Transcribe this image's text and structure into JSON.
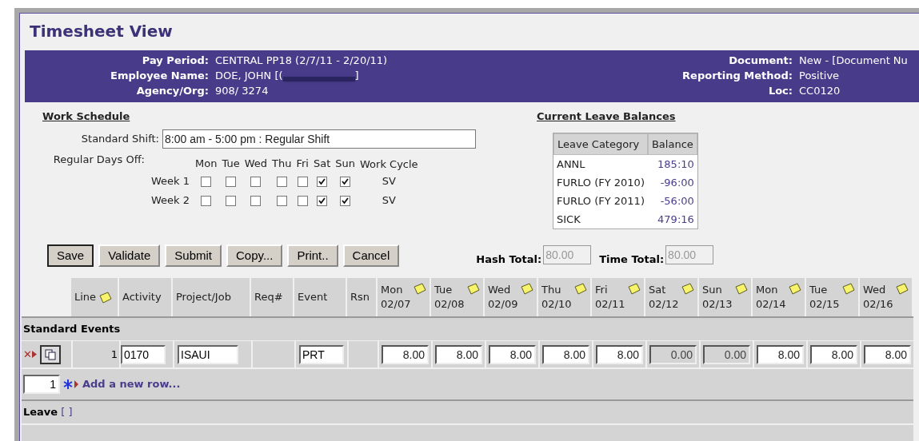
{
  "title": "Timesheet View",
  "header_left": [
    {
      "label": "Pay Period:",
      "value": "CENTRAL PP18 (2/7/11 - 2/20/11)"
    },
    {
      "label": "Employee Name:",
      "value": "DOE, JOHN [(",
      "suffix": "]",
      "redacted": true
    },
    {
      "label": "Agency/Org:",
      "value": "908/ 3274"
    }
  ],
  "header_right": [
    {
      "label": "Document:",
      "value": "New - [Document Nu"
    },
    {
      "label": "Reporting Method:",
      "value": "Positive"
    },
    {
      "label": "Loc:",
      "value": "CC0120"
    }
  ],
  "work_schedule": {
    "heading": "Work Schedule",
    "shift_label": "Standard Shift:",
    "shift_value": "8:00 am - 5:00 pm : Regular Shift",
    "days_off_label": "Regular Days Off:",
    "days": [
      "Mon",
      "Tue",
      "Wed",
      "Thu",
      "Fri",
      "Sat",
      "Sun"
    ],
    "cycle_heading": "Work Cycle",
    "weeks": [
      {
        "label": "Week 1",
        "checked": [
          false,
          false,
          false,
          false,
          false,
          true,
          true
        ],
        "cycle": "SV"
      },
      {
        "label": "Week 2",
        "checked": [
          false,
          false,
          false,
          false,
          false,
          true,
          true
        ],
        "cycle": "SV"
      }
    ]
  },
  "leave_balances": {
    "heading": "Current Leave Balances",
    "columns": [
      "Leave Category",
      "Balance"
    ],
    "rows": [
      [
        "ANNL",
        "185:10"
      ],
      [
        "FURLO (FY 2010)",
        "-96:00"
      ],
      [
        "FURLO (FY 2011)",
        "-56:00"
      ],
      [
        "SICK",
        "479:16"
      ]
    ]
  },
  "buttons": [
    {
      "label": "Save",
      "selected": true
    },
    {
      "label": "Validate",
      "selected": false
    },
    {
      "label": "Submit",
      "selected": false
    },
    {
      "label": "Copy...",
      "selected": false
    },
    {
      "label": "Print..",
      "selected": false
    },
    {
      "label": "Cancel",
      "selected": false
    }
  ],
  "totals": [
    {
      "label": "Hash Total:",
      "placeholder": "80.00"
    },
    {
      "label": "Time Total:",
      "placeholder": "80.00"
    }
  ],
  "grid": {
    "columns": [
      {
        "label": "Line",
        "note": true
      },
      {
        "label": "Activity"
      },
      {
        "label": "Project/Job"
      },
      {
        "label": "Req#"
      },
      {
        "label": "Event"
      },
      {
        "label": "Rsn"
      }
    ],
    "days": [
      {
        "day": "Mon",
        "date": "02/07"
      },
      {
        "day": "Tue",
        "date": "02/08"
      },
      {
        "day": "Wed",
        "date": "02/09"
      },
      {
        "day": "Thu",
        "date": "02/10"
      },
      {
        "day": "Fri",
        "date": "02/11"
      },
      {
        "day": "Sat",
        "date": "02/12"
      },
      {
        "day": "Sun",
        "date": "02/13"
      },
      {
        "day": "Mon",
        "date": "02/14"
      },
      {
        "day": "Tue",
        "date": "02/15"
      },
      {
        "day": "Wed",
        "date": "02/16"
      }
    ],
    "sections": [
      {
        "title": "Standard Events",
        "rows": [
          {
            "line": "1",
            "activity": "0170",
            "project": "ISAUI",
            "event": "PRT",
            "delete_mark": "✕",
            "hours": [
              {
                "value": "8.00",
                "disabled": false
              },
              {
                "value": "8.00",
                "disabled": false
              },
              {
                "value": "8.00",
                "disabled": false
              },
              {
                "value": "8.00",
                "disabled": false
              },
              {
                "value": "8.00",
                "disabled": false
              },
              {
                "value": "0.00",
                "disabled": true
              },
              {
                "value": "0.00",
                "disabled": true
              },
              {
                "value": "8.00",
                "disabled": false
              },
              {
                "value": "8.00",
                "disabled": false
              },
              {
                "value": "8.00",
                "disabled": false
              }
            ]
          }
        ],
        "add_count": "1",
        "add_label": "Add a new row..."
      },
      {
        "title": "Leave",
        "brackets": "[ ]"
      }
    ]
  }
}
